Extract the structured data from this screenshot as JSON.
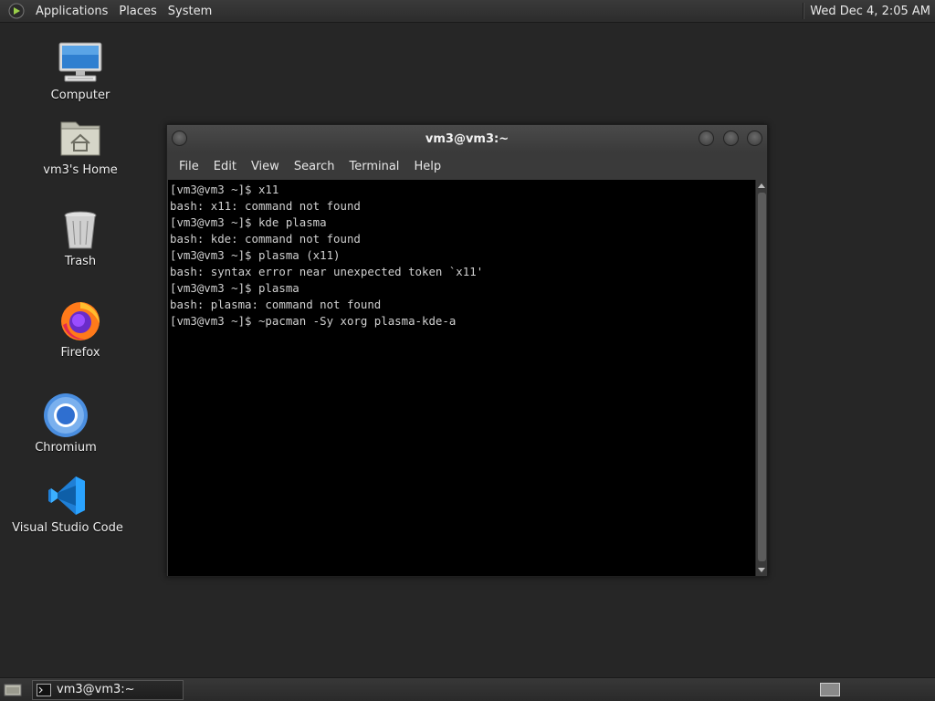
{
  "top_panel": {
    "menus": [
      "Applications",
      "Places",
      "System"
    ],
    "clock": "Wed Dec 4, 2:05 AM"
  },
  "desktop_icons": [
    {
      "label": "Computer",
      "icon": "computer-icon"
    },
    {
      "label": "vm3's Home",
      "icon": "home-folder-icon"
    },
    {
      "label": "Trash",
      "icon": "trash-icon"
    },
    {
      "label": "Firefox",
      "icon": "firefox-icon"
    },
    {
      "label": "Chromium",
      "icon": "chromium-icon"
    },
    {
      "label": "Visual Studio Code",
      "icon": "vscode-icon"
    }
  ],
  "terminal": {
    "title": "vm3@vm3:~",
    "menu": [
      "File",
      "Edit",
      "View",
      "Search",
      "Terminal",
      "Help"
    ],
    "lines": [
      "[vm3@vm3 ~]$ x11",
      "bash: x11: command not found",
      "[vm3@vm3 ~]$ kde plasma",
      "bash: kde: command not found",
      "[vm3@vm3 ~]$ plasma (x11)",
      "bash: syntax error near unexpected token `x11'",
      "[vm3@vm3 ~]$ plasma",
      "bash: plasma: command not found",
      "[vm3@vm3 ~]$ ~pacman -Sy xorg plasma-kde-a"
    ]
  },
  "bottom_panel": {
    "task_label": "vm3@vm3:~"
  },
  "colors": {
    "desktop_bg": "#262626",
    "terminal_bg": "#000000",
    "terminal_fg": "#d0d0d0"
  }
}
